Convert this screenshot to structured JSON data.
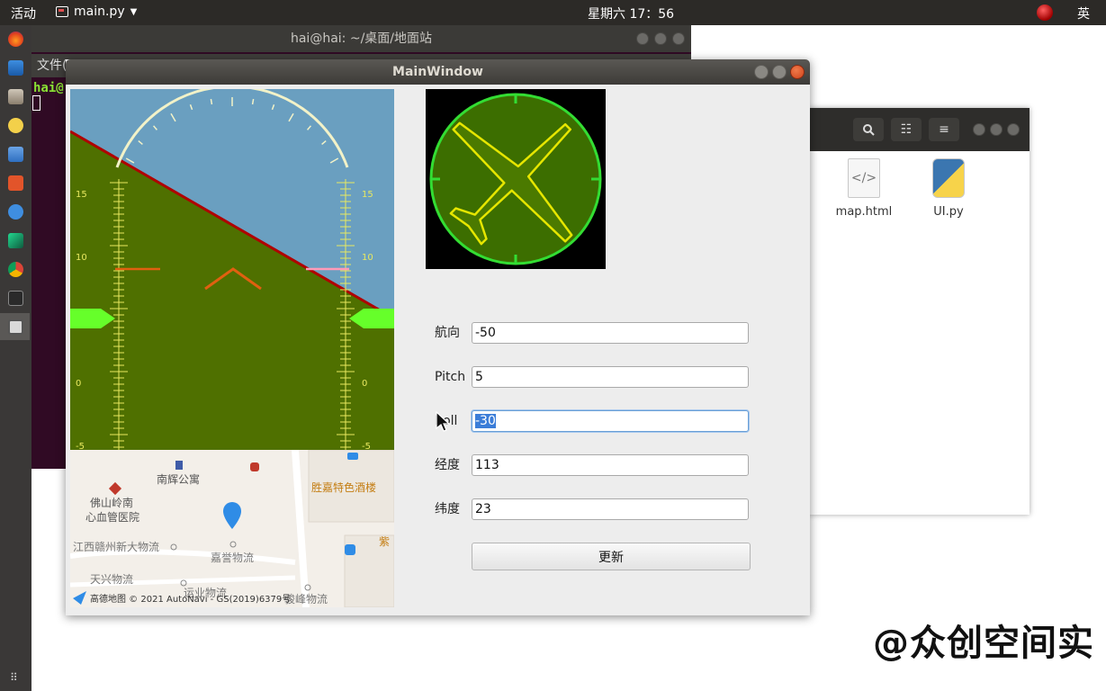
{
  "topbar": {
    "activities": "活动",
    "app_name": "main.py",
    "clock": "星期六 17：56",
    "input_method": "英"
  },
  "terminal": {
    "title": "hai@hai: ~/桌面/地面站",
    "menu": "文件(",
    "prompt": "hai@"
  },
  "files": {
    "items": [
      {
        "name": "map.html",
        "icon": "html-file-icon"
      },
      {
        "name": "UI.py",
        "icon": "python-file-icon"
      }
    ]
  },
  "main_window": {
    "title": "MainWindow",
    "pfd": {
      "pitch_ticks": [
        "15",
        "10",
        "0",
        "-5"
      ],
      "pitch_value": 5,
      "roll_value": -30,
      "sky_color": "#6a9fc0",
      "ground_color": "#4f7000"
    },
    "map": {
      "labels": {
        "apartment": "南辉公寓",
        "hospital_line1": "佛山岭南",
        "hospital_line2": "心血管医院",
        "restaurant": "胜嘉特色酒楼",
        "logistics1": "江西赣州新大物流",
        "logistics2": "嘉誉物流",
        "logistics3": "天兴物流",
        "logistics4": "运业物流",
        "logistics5": "骏峰物流",
        "partial": "紫"
      },
      "copyright": "高德地图 © 2021 AutoNavi - GS(2019)6379号"
    },
    "compass": {
      "heading_value": -50
    },
    "fields": [
      {
        "label": "航向",
        "value": "-50"
      },
      {
        "label": "Pitch",
        "value": "5"
      },
      {
        "label": "Roll",
        "value": "-30"
      },
      {
        "label": "经度",
        "value": "113"
      },
      {
        "label": "纬度",
        "value": "23"
      }
    ],
    "update_label": "更新"
  },
  "watermark": "@众创空间实",
  "colors": {
    "accent_green": "#33dd33",
    "plane_yellow": "#e6e600",
    "marker_blue": "#2f8ce6"
  }
}
